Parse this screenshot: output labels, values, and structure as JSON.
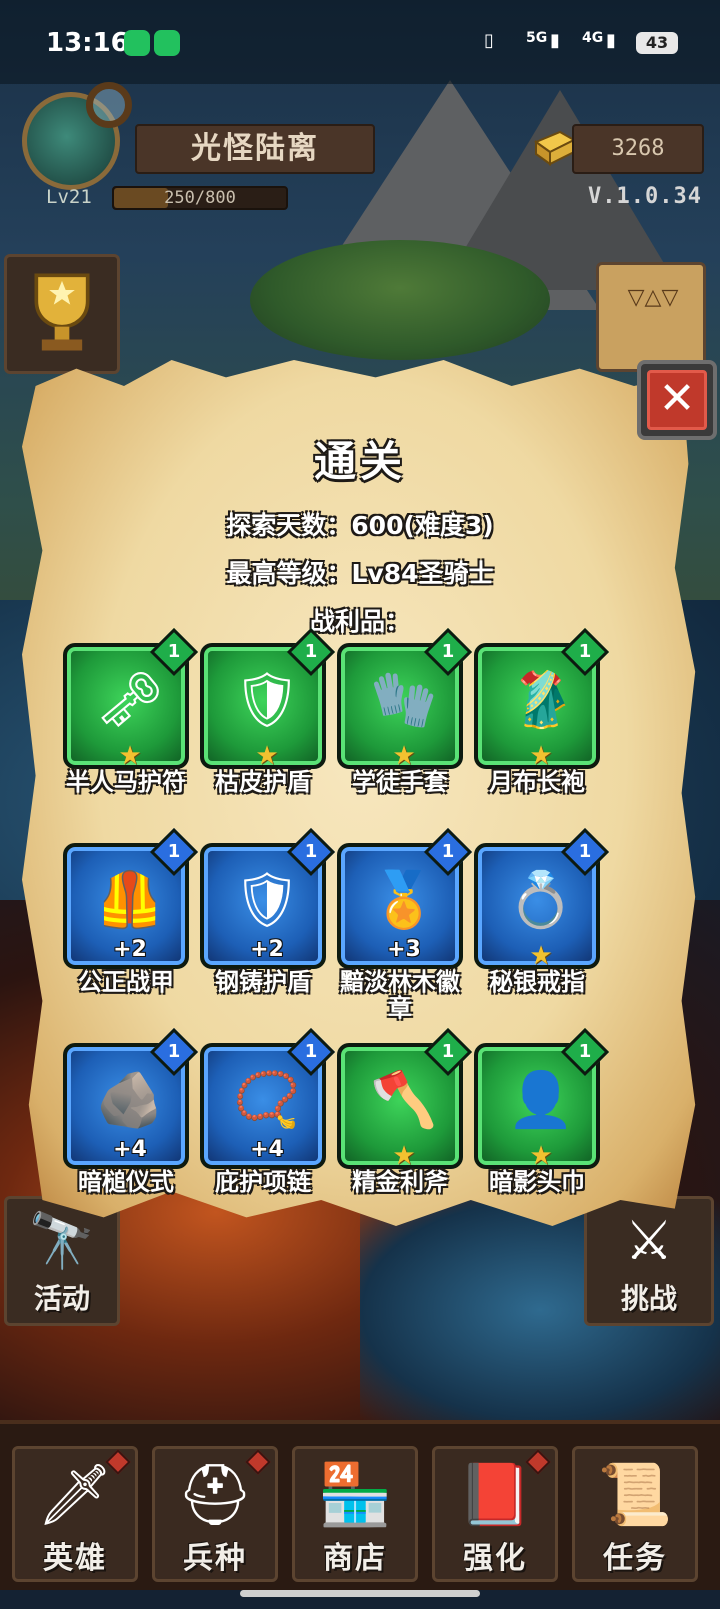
{
  "status_bar": {
    "time": "13:16",
    "network_5g": "5G",
    "network_4g": "4G",
    "battery": "43"
  },
  "hud": {
    "player_name": "光怪陆离",
    "level": "Lv21",
    "xp": "250/800",
    "xp_fraction": 0.3125,
    "gold": "3268",
    "version": "V.1.0.34"
  },
  "dialog": {
    "title": "通关",
    "explore_days": "探索天数：600(难度3)",
    "max_level": "最高等级：Lv84圣骑士",
    "loot_label": "战利品：",
    "loot": [
      {
        "name": "半人马护符",
        "rarity": "green",
        "count": "1",
        "icon": "amulet-icon",
        "glyph": "🗝",
        "star": true,
        "plus": ""
      },
      {
        "name": "枯皮护盾",
        "rarity": "green",
        "count": "1",
        "icon": "shield-icon",
        "glyph": "🛡",
        "star": true,
        "plus": ""
      },
      {
        "name": "学徒手套",
        "rarity": "green",
        "count": "1",
        "icon": "gauntlet-icon",
        "glyph": "🧤",
        "star": true,
        "plus": ""
      },
      {
        "name": "月布长袍",
        "rarity": "green",
        "count": "1",
        "icon": "robe-icon",
        "glyph": "🥻",
        "star": true,
        "plus": ""
      },
      {
        "name": "公正战甲",
        "rarity": "blue",
        "count": "1",
        "icon": "armor-icon",
        "glyph": "🦺",
        "star": false,
        "plus": "+2"
      },
      {
        "name": "钢铸护盾",
        "rarity": "blue",
        "count": "1",
        "icon": "steel-shield-icon",
        "glyph": "🛡",
        "star": false,
        "plus": "+2"
      },
      {
        "name": "黯淡林木徽章",
        "rarity": "blue",
        "count": "1",
        "icon": "badge-icon",
        "glyph": "🏅",
        "star": false,
        "plus": "+3"
      },
      {
        "name": "秘银戒指",
        "rarity": "blue",
        "count": "1",
        "icon": "ring-icon",
        "glyph": "💍",
        "star": true,
        "plus": ""
      },
      {
        "name": "暗槌仪式",
        "rarity": "blue",
        "count": "1",
        "icon": "ritual-icon",
        "glyph": "🪨",
        "star": false,
        "plus": "+4"
      },
      {
        "name": "庇护项链",
        "rarity": "blue",
        "count": "1",
        "icon": "necklace-icon",
        "glyph": "📿",
        "star": false,
        "plus": "+4"
      },
      {
        "name": "精金利斧",
        "rarity": "green",
        "count": "1",
        "icon": "axe-icon",
        "glyph": "🪓",
        "star": true,
        "plus": ""
      },
      {
        "name": "暗影头巾",
        "rarity": "green",
        "count": "1",
        "icon": "hood-icon",
        "glyph": "👤",
        "star": true,
        "plus": ""
      }
    ]
  },
  "side_buttons": {
    "activity": "活动",
    "challenge": "挑战"
  },
  "bottom_nav": [
    {
      "label": "英雄",
      "icon": "sword-icon",
      "glyph": "🗡",
      "badge": true
    },
    {
      "label": "兵种",
      "icon": "helmet-icon",
      "glyph": "⛑",
      "badge": true
    },
    {
      "label": "商店",
      "icon": "shop-icon",
      "glyph": "🏪",
      "badge": false
    },
    {
      "label": "强化",
      "icon": "book-icon",
      "glyph": "📕",
      "badge": true
    },
    {
      "label": "任务",
      "icon": "scroll-icon",
      "glyph": "📜",
      "badge": false
    }
  ],
  "colors": {
    "green_rarity": "#1fae4a",
    "blue_rarity": "#2a6ee0",
    "star": "#f2c230",
    "close_red": "#c0392b"
  }
}
